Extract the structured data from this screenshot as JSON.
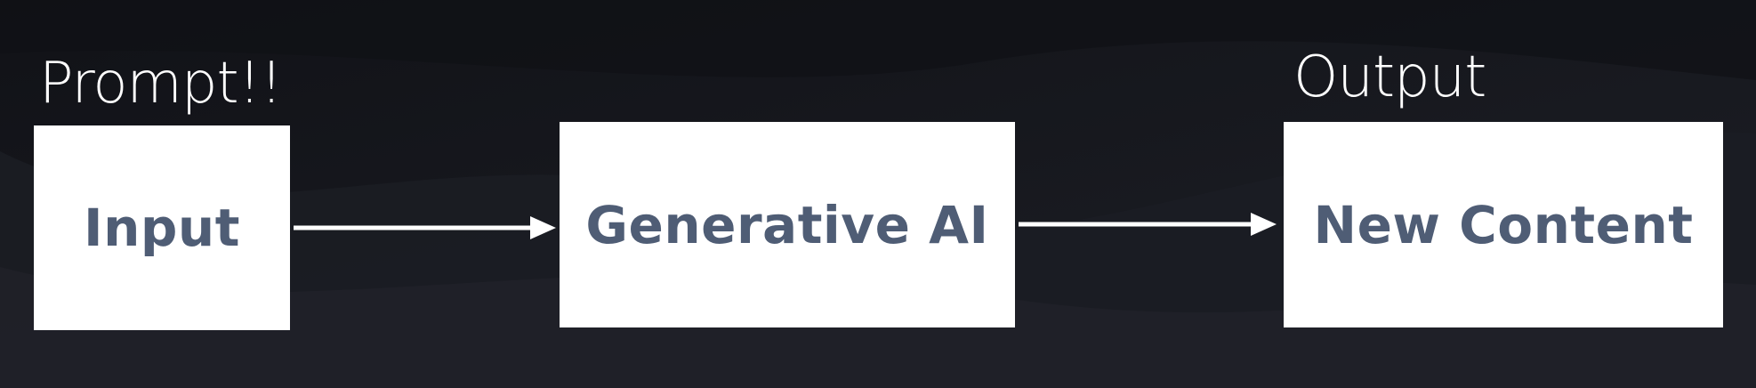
{
  "diagram": {
    "caption_left": "Prompt!!",
    "caption_right": "Output",
    "nodes": [
      {
        "id": "input",
        "label": "Input"
      },
      {
        "id": "generative-ai",
        "label": "Generative AI"
      },
      {
        "id": "new-content",
        "label": "New Content"
      }
    ],
    "edges": [
      {
        "from": "input",
        "to": "generative-ai"
      },
      {
        "from": "generative-ai",
        "to": "new-content"
      }
    ]
  },
  "colors": {
    "background": "#15161c",
    "box": "#ffffff",
    "box_text": "#4f5d75",
    "caption_text": "#ffffff",
    "arrow": "#ffffff"
  }
}
